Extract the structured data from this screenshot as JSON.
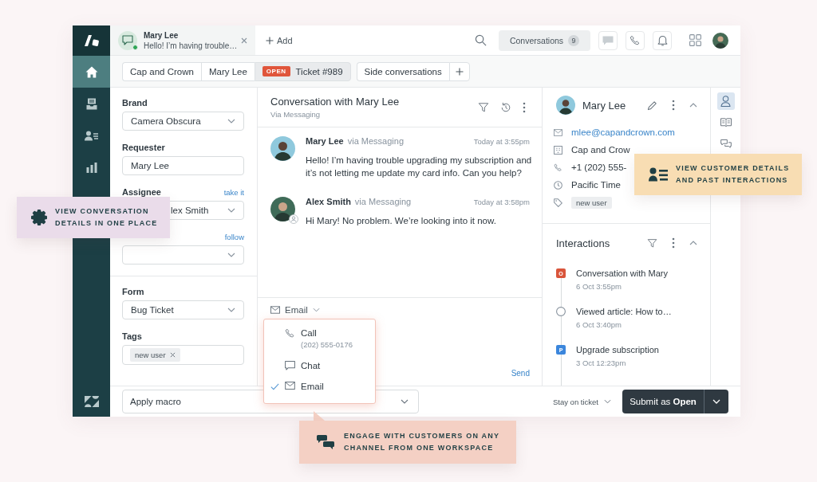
{
  "nav": {
    "items": [
      {
        "selected": true
      },
      {
        "selected": false
      },
      {
        "selected": false
      },
      {
        "selected": false
      }
    ]
  },
  "top_bar": {
    "conversation_tab": {
      "name": "Mary Lee",
      "preview": "Hello! I’m having trouble…",
      "online": true
    },
    "add_button": "Add",
    "conversations": {
      "label": "Conversations",
      "count": "9"
    }
  },
  "breadcrumbs": {
    "items": [
      {
        "label": "Cap and Crown",
        "selected": false
      },
      {
        "label": "Mary Lee",
        "selected": false
      },
      {
        "label": "Ticket #989",
        "status": "OPEN",
        "selected": true
      }
    ],
    "side_conversations": "Side conversations"
  },
  "ticket_fields": {
    "brand": {
      "label": "Brand",
      "value": "Camera Obscura"
    },
    "requester": {
      "label": "Requester",
      "value": "Mary Lee"
    },
    "assignee": {
      "label": "Assignee",
      "link": "take it",
      "value": "lex Smith"
    },
    "followers": {
      "link": "follow"
    },
    "form": {
      "label": "Form",
      "value": "Bug Ticket"
    },
    "tags": {
      "label": "Tags",
      "items": [
        "new user"
      ]
    }
  },
  "conversation": {
    "title": "Conversation with Mary Lee",
    "subtitle": "Via Messaging",
    "messages": [
      {
        "author": "Mary Lee",
        "channel": "via Messaging",
        "time": "Today at 3:55pm",
        "text": "Hello! I’m having trouble upgrading my subscription and it’s not letting me update my card info. Can you help?",
        "agent": false
      },
      {
        "author": "Alex Smith",
        "channel": "via Messaging",
        "time": "Today at 3:58pm",
        "text": "Hi Mary! No problem. We’re looking into it now.",
        "agent": true
      }
    ]
  },
  "composer": {
    "channel": "Email",
    "send": "Send",
    "menu": [
      {
        "kind": "call",
        "label": "Call",
        "detail": "(202) 555-0176",
        "selected": false
      },
      {
        "kind": "chat",
        "label": "Chat",
        "selected": false
      },
      {
        "kind": "email",
        "label": "Email",
        "selected": true
      }
    ]
  },
  "customer": {
    "name": "Mary Lee",
    "email": "mlee@capandcrown.com",
    "organization": "Cap and Crow",
    "phone": "+1 (202) 555-",
    "timezone": "Pacific Time",
    "tags": [
      "new user"
    ]
  },
  "interactions": {
    "title": "Interactions",
    "items": [
      {
        "kind": "conversation",
        "badge": "O",
        "color": "#d9553b",
        "title": "Conversation with Mary",
        "time": "6 Oct 3:55pm"
      },
      {
        "kind": "article",
        "title": "Viewed article: How to…",
        "time": "6 Oct 3:40pm"
      },
      {
        "kind": "ticket",
        "badge": "P",
        "color": "#3b86dc",
        "title": "Upgrade subscription",
        "time": "3 Oct 12:23pm"
      }
    ]
  },
  "side_rail": {
    "items": [
      {
        "selected": true
      },
      {
        "selected": false
      },
      {
        "selected": false
      }
    ]
  },
  "footer": {
    "macro": {
      "placeholder": "Apply macro"
    },
    "stay_option": "Stay on ticket",
    "submit": "Submit as **Open**"
  },
  "callouts": [
    {
      "text": "VIEW CONVERSATION DETAILS IN ONE PLACE",
      "color": "#eadcea"
    },
    {
      "text": "VIEW CUSTOMER DETAILS AND PAST INTERACTIONS",
      "color": "#f8ddb3"
    },
    {
      "text": "ENGAGE WITH CUSTOMERS ON ANY CHANNEL FROM ONE WORKSPACE",
      "color": "#f4d0c4"
    }
  ]
}
